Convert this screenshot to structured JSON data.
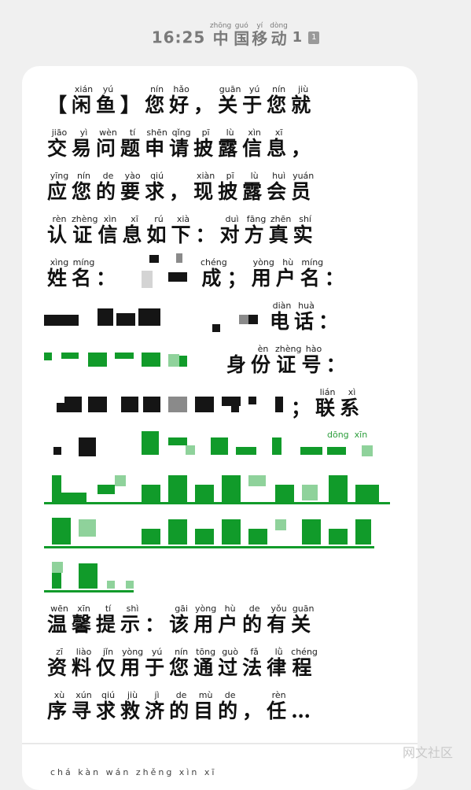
{
  "status_bar": {
    "time": "16:25",
    "carrier": [
      {
        "char": "中",
        "pinyin": "zhōng"
      },
      {
        "char": "国",
        "pinyin": "guó"
      },
      {
        "char": "移",
        "pinyin": "yí"
      },
      {
        "char": "动",
        "pinyin": "dòng"
      }
    ],
    "sim": "1",
    "sim_badge": "1"
  },
  "message": {
    "line1": [
      {
        "char": "【",
        "pinyin": ""
      },
      {
        "char": "闲",
        "pinyin": "xián"
      },
      {
        "char": "鱼",
        "pinyin": "yú"
      },
      {
        "char": "】",
        "pinyin": ""
      },
      {
        "char": "您",
        "pinyin": "nín"
      },
      {
        "char": "好",
        "pinyin": "hǎo"
      },
      {
        "char": "，",
        "pinyin": ""
      },
      {
        "char": "关",
        "pinyin": "guān"
      },
      {
        "char": "于",
        "pinyin": "yú"
      },
      {
        "char": "您",
        "pinyin": "nín"
      },
      {
        "char": "就",
        "pinyin": "jiù"
      }
    ],
    "line2": [
      {
        "char": "交",
        "pinyin": "jiāo"
      },
      {
        "char": "易",
        "pinyin": "yì"
      },
      {
        "char": "问",
        "pinyin": "wèn"
      },
      {
        "char": "题",
        "pinyin": "tí"
      },
      {
        "char": "申",
        "pinyin": "shēn"
      },
      {
        "char": "请",
        "pinyin": "qǐng"
      },
      {
        "char": "披",
        "pinyin": "pī"
      },
      {
        "char": "露",
        "pinyin": "lù"
      },
      {
        "char": "信",
        "pinyin": "xìn"
      },
      {
        "char": "息",
        "pinyin": "xī"
      },
      {
        "char": "，",
        "pinyin": ""
      }
    ],
    "line3": [
      {
        "char": "应",
        "pinyin": "yīng"
      },
      {
        "char": "您",
        "pinyin": "nín"
      },
      {
        "char": "的",
        "pinyin": "de"
      },
      {
        "char": "要",
        "pinyin": "yào"
      },
      {
        "char": "求",
        "pinyin": "qiú"
      },
      {
        "char": "，",
        "pinyin": ""
      },
      {
        "char": "现",
        "pinyin": "xiàn"
      },
      {
        "char": "披",
        "pinyin": "pī"
      },
      {
        "char": "露",
        "pinyin": "lù"
      },
      {
        "char": "会",
        "pinyin": "huì"
      },
      {
        "char": "员",
        "pinyin": "yuán"
      }
    ],
    "line4": [
      {
        "char": "认",
        "pinyin": "rèn"
      },
      {
        "char": "证",
        "pinyin": "zhèng"
      },
      {
        "char": "信",
        "pinyin": "xìn"
      },
      {
        "char": "息",
        "pinyin": "xī"
      },
      {
        "char": "如",
        "pinyin": "rú"
      },
      {
        "char": "下",
        "pinyin": "xià"
      },
      {
        "char": "：",
        "pinyin": ""
      },
      {
        "char": "对",
        "pinyin": "duì"
      },
      {
        "char": "方",
        "pinyin": "fāng"
      },
      {
        "char": "真",
        "pinyin": "zhēn"
      },
      {
        "char": "实",
        "pinyin": "shí"
      }
    ],
    "line5a": [
      {
        "char": "姓",
        "pinyin": "xìng"
      },
      {
        "char": "名",
        "pinyin": "míng"
      },
      {
        "char": "：",
        "pinyin": ""
      }
    ],
    "line5b": [
      {
        "char": "成",
        "pinyin": "chéng"
      },
      {
        "char": "；",
        "pinyin": ""
      },
      {
        "char": "用",
        "pinyin": "yòng"
      },
      {
        "char": "户",
        "pinyin": "hù"
      },
      {
        "char": "名",
        "pinyin": "míng"
      },
      {
        "char": "：",
        "pinyin": ""
      }
    ],
    "line6": [
      {
        "char": "电",
        "pinyin": "diàn"
      },
      {
        "char": "话",
        "pinyin": "huà"
      },
      {
        "char": "：",
        "pinyin": ""
      }
    ],
    "line7": [
      {
        "char": "身",
        "pinyin": ""
      },
      {
        "char": "份",
        "pinyin": "èn"
      },
      {
        "char": "证",
        "pinyin": "zhèng"
      },
      {
        "char": "号",
        "pinyin": "hào"
      },
      {
        "char": "：",
        "pinyin": ""
      }
    ],
    "line8": [
      {
        "char": "；",
        "pinyin": ""
      },
      {
        "char": "联",
        "pinyin": "lián"
      },
      {
        "char": "系",
        "pinyin": "xì"
      }
    ],
    "line9_partial_pinyin": [
      "dōng",
      "xīn"
    ],
    "line12": [
      {
        "char": "温",
        "pinyin": "wēn"
      },
      {
        "char": "馨",
        "pinyin": "xīn"
      },
      {
        "char": "提",
        "pinyin": "tí"
      },
      {
        "char": "示",
        "pinyin": "shì"
      },
      {
        "char": "：",
        "pinyin": ""
      },
      {
        "char": "该",
        "pinyin": "gāi"
      },
      {
        "char": "用",
        "pinyin": "yòng"
      },
      {
        "char": "户",
        "pinyin": "hù"
      },
      {
        "char": "的",
        "pinyin": "de"
      },
      {
        "char": "有",
        "pinyin": "yǒu"
      },
      {
        "char": "关",
        "pinyin": "guān"
      }
    ],
    "line13": [
      {
        "char": "资",
        "pinyin": "zī"
      },
      {
        "char": "料",
        "pinyin": "liào"
      },
      {
        "char": "仅",
        "pinyin": "jǐn"
      },
      {
        "char": "用",
        "pinyin": "yòng"
      },
      {
        "char": "于",
        "pinyin": "yú"
      },
      {
        "char": "您",
        "pinyin": "nín"
      },
      {
        "char": "通",
        "pinyin": "tōng"
      },
      {
        "char": "过",
        "pinyin": "guò"
      },
      {
        "char": "法",
        "pinyin": "fǎ"
      },
      {
        "char": "律",
        "pinyin": "lǜ"
      },
      {
        "char": "程",
        "pinyin": "chéng"
      }
    ],
    "line14": [
      {
        "char": "序",
        "pinyin": "xù"
      },
      {
        "char": "寻",
        "pinyin": "xún"
      },
      {
        "char": "求",
        "pinyin": "qiú"
      },
      {
        "char": "救",
        "pinyin": "jiù"
      },
      {
        "char": "济",
        "pinyin": "jì"
      },
      {
        "char": "的",
        "pinyin": "de"
      },
      {
        "char": "目",
        "pinyin": "mù"
      },
      {
        "char": "的",
        "pinyin": "de"
      },
      {
        "char": "，",
        "pinyin": ""
      },
      {
        "char": "任",
        "pinyin": "rèn"
      },
      {
        "char": "…",
        "pinyin": ""
      }
    ]
  },
  "bottom_peek": "chá kàn wán zhěng xìn xī",
  "watermark": "网文社区",
  "colors": {
    "background": "#f0f0f0",
    "card": "#ffffff",
    "redaction_dark": "#151515",
    "redaction_green": "#119b2a",
    "status_text": "#7a7a7a"
  }
}
